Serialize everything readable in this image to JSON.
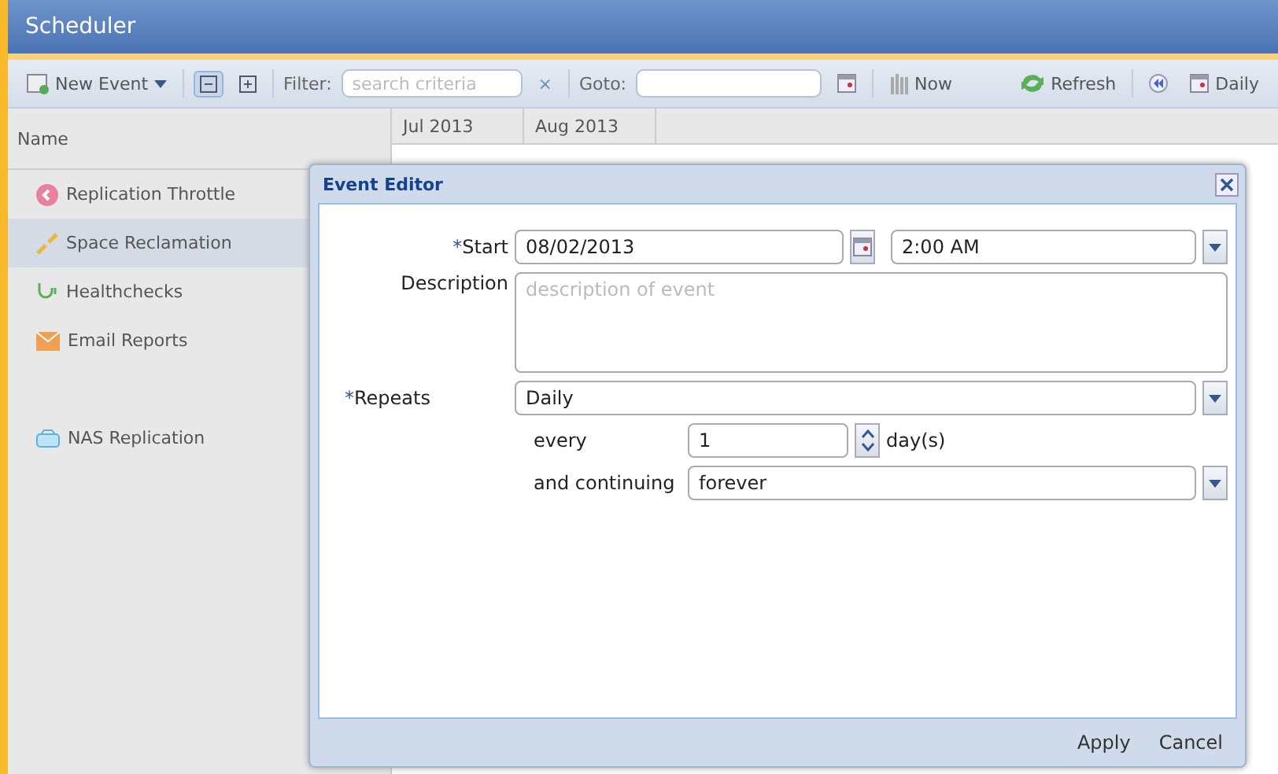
{
  "window": {
    "title": "Scheduler"
  },
  "toolbar": {
    "new_event": "New Event",
    "filter_label": "Filter:",
    "filter_placeholder": "search criteria",
    "clear": "×",
    "goto_label": "Goto:",
    "now": "Now",
    "refresh": "Refresh",
    "daily": "Daily",
    "collapse_selected": true
  },
  "grid": {
    "name_header": "Name",
    "months": [
      "Jul 2013",
      "Aug 2013"
    ],
    "rows": [
      {
        "name": "Replication Throttle",
        "kind": "throttle",
        "selected": false
      },
      {
        "name": "Space Reclamation",
        "kind": "reclaim",
        "selected": true
      },
      {
        "name": "Healthchecks",
        "kind": "health",
        "selected": false
      },
      {
        "name": "Email Reports",
        "kind": "email",
        "selected": false
      },
      {
        "kind": "blank",
        "selected": false
      },
      {
        "name": "NAS Replication",
        "kind": "nas",
        "selected": false
      }
    ]
  },
  "dialog": {
    "title": "Event Editor",
    "start_label": "Start",
    "start_date": "08/02/2013",
    "start_time": "2:00 AM",
    "description_label": "Description",
    "description_placeholder": "description of event",
    "repeats_label": "Repeats",
    "repeats": "Daily",
    "every_label": "every",
    "every": "1",
    "unit": "day(s)",
    "continuing_label": "and continuing",
    "continuing": "forever",
    "required_mark": "*",
    "buttons": [
      "Apply",
      "Cancel"
    ]
  }
}
